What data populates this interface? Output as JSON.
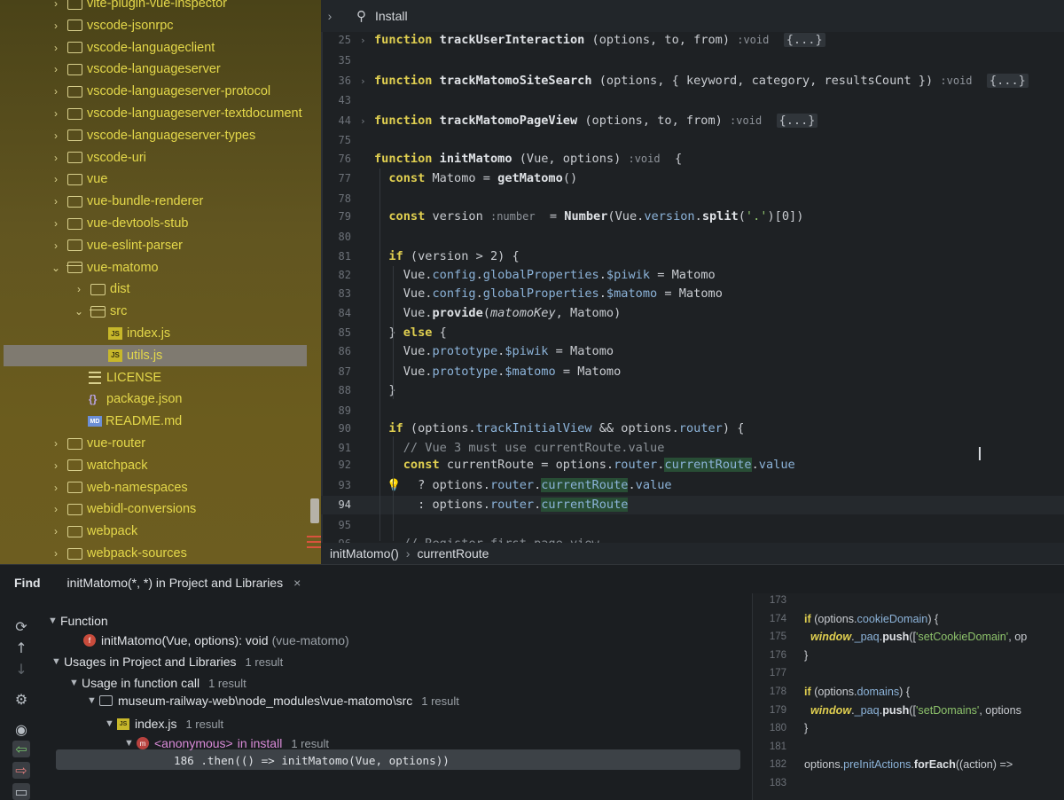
{
  "tree": {
    "items": [
      {
        "label": "vite-plugin-vue-inspector",
        "type": "folder",
        "depth": 0,
        "expanded": false
      },
      {
        "label": "vscode-jsonrpc",
        "type": "folder",
        "depth": 0,
        "expanded": false
      },
      {
        "label": "vscode-languageclient",
        "type": "folder",
        "depth": 0,
        "expanded": false
      },
      {
        "label": "vscode-languageserver",
        "type": "folder",
        "depth": 0,
        "expanded": false
      },
      {
        "label": "vscode-languageserver-protocol",
        "type": "folder",
        "depth": 0,
        "expanded": false
      },
      {
        "label": "vscode-languageserver-textdocument",
        "type": "folder",
        "depth": 0,
        "expanded": false
      },
      {
        "label": "vscode-languageserver-types",
        "type": "folder",
        "depth": 0,
        "expanded": false
      },
      {
        "label": "vscode-uri",
        "type": "folder",
        "depth": 0,
        "expanded": false
      },
      {
        "label": "vue",
        "type": "folder",
        "depth": 0,
        "expanded": false
      },
      {
        "label": "vue-bundle-renderer",
        "type": "folder",
        "depth": 0,
        "expanded": false
      },
      {
        "label": "vue-devtools-stub",
        "type": "folder",
        "depth": 0,
        "expanded": false
      },
      {
        "label": "vue-eslint-parser",
        "type": "folder",
        "depth": 0,
        "expanded": false
      },
      {
        "label": "vue-matomo",
        "type": "folder",
        "depth": 0,
        "expanded": true
      },
      {
        "label": "dist",
        "type": "folder",
        "depth": 1,
        "expanded": false
      },
      {
        "label": "src",
        "type": "folder",
        "depth": 1,
        "expanded": true
      },
      {
        "label": "index.js",
        "type": "js",
        "depth": 2
      },
      {
        "label": "utils.js",
        "type": "js",
        "depth": 2,
        "selected": true
      },
      {
        "label": "LICENSE",
        "type": "txt",
        "depth": 1
      },
      {
        "label": "package.json",
        "type": "json",
        "depth": 1
      },
      {
        "label": "README.md",
        "type": "md",
        "depth": 1
      },
      {
        "label": "vue-router",
        "type": "folder",
        "depth": 0,
        "expanded": false
      },
      {
        "label": "watchpack",
        "type": "folder",
        "depth": 0,
        "expanded": false
      },
      {
        "label": "web-namespaces",
        "type": "folder",
        "depth": 0,
        "expanded": false
      },
      {
        "label": "webidl-conversions",
        "type": "folder",
        "depth": 0,
        "expanded": false
      },
      {
        "label": "webpack",
        "type": "folder",
        "depth": 0,
        "expanded": false
      },
      {
        "label": "webpack-sources",
        "type": "folder",
        "depth": 0,
        "expanded": false
      }
    ]
  },
  "editor": {
    "search_label": "Install",
    "lines": [
      {
        "n": "25",
        "fold": true,
        "html": "<span class='kw'>function</span> <span class='fn'>trackUserInteraction</span> (options, to, from) <span class='hint'>:void</span>  <span class='fold-box'>{...}</span>"
      },
      {
        "n": "35",
        "html": ""
      },
      {
        "n": "36",
        "fold": true,
        "html": "<span class='kw'>function</span> <span class='fn'>trackMatomoSiteSearch</span> (options, { keyword, category, resultsCount }) <span class='hint'>:void</span>  <span class='fold-box'>{...}</span>"
      },
      {
        "n": "43",
        "html": ""
      },
      {
        "n": "44",
        "fold": true,
        "html": "<span class='kw'>function</span> <span class='fn'>trackMatomoPageView</span> (options, to, from) <span class='hint'>:void</span>  <span class='fold-box'>{...}</span>"
      },
      {
        "n": "75",
        "html": ""
      },
      {
        "n": "76",
        "html": "<span class='kw'>function</span> <span class='fn'>initMatomo</span> (Vue, options) <span class='hint'>:void</span>  {"
      },
      {
        "n": "77",
        "html": "  <span class='kw'>const</span> Matomo = <span class='fn'>getMatomo</span>()"
      },
      {
        "n": "78",
        "html": ""
      },
      {
        "n": "79",
        "html": "  <span class='kw'>const</span> version <span class='hint'>:number</span>  = <span class='fn'>Number</span>(Vue.<span class='prop'>version</span>.<span class='fn'>split</span>(<span class='str'>'.'</span>)[0])"
      },
      {
        "n": "80",
        "html": ""
      },
      {
        "n": "81",
        "html": "  <span class='kw'>if</span> (version > 2) {"
      },
      {
        "n": "82",
        "html": "    Vue.<span class='prop'>config</span>.<span class='prop'>globalProperties</span>.<span class='prop'>$piwik</span> = Matomo"
      },
      {
        "n": "83",
        "html": "    Vue.<span class='prop'>config</span>.<span class='prop'>globalProperties</span>.<span class='prop'>$matomo</span> = Matomo"
      },
      {
        "n": "84",
        "html": "    Vue.<span class='fn'>provide</span>(<i>matomoKey</i>, Matomo)"
      },
      {
        "n": "85",
        "html": "  } <span class='kw'>else</span> {"
      },
      {
        "n": "86",
        "html": "    Vue.<span class='prop'>prototype</span>.<span class='prop'>$piwik</span> = Matomo"
      },
      {
        "n": "87",
        "html": "    Vue.<span class='prop'>prototype</span>.<span class='prop'>$matomo</span> = Matomo"
      },
      {
        "n": "88",
        "html": "  }"
      },
      {
        "n": "89",
        "html": ""
      },
      {
        "n": "90",
        "html": "  <span class='kw'>if</span> (options.<span class='prop'>trackInitialView</span> && options.<span class='prop'>router</span>) {"
      },
      {
        "n": "91",
        "html": "    <span class='cm'>// Vue 3 must use currentRoute.value</span>"
      },
      {
        "n": "92",
        "html": "    <span class='kw'>const</span> currentRoute = options.<span class='prop'>router</span>.<span class='mark'><span class='prop'>currentRoute</span></span>.<span class='prop'>value</span>"
      },
      {
        "n": "93",
        "bulb": true,
        "html": "      ? options.<span class='prop'>router</span>.<span class='mark'><span class='prop'>currentRoute</span></span>.<span class='prop'>value</span>"
      },
      {
        "n": "94",
        "current": true,
        "html": "      : options.<span class='prop'>router</span>.<span class='mark'><span class='prop'>currentRoute</span></span>"
      },
      {
        "n": "95",
        "html": ""
      },
      {
        "n": "96",
        "html": "    <span class='cm'>// Register first page view</span>"
      }
    ]
  },
  "breadcrumb": {
    "items": [
      "initMatomo()",
      "currentRoute"
    ]
  },
  "find": {
    "title": "Find",
    "tab_label": "initMatomo(*, *) in Project and Libraries",
    "close_glyph": "×",
    "function_header": "Function",
    "function_sig": "initMatomo(Vue, options): void",
    "function_module": "(vue-matomo)",
    "usages_header": "Usages in Project and Libraries",
    "usages_count": "1 result",
    "usage_kind": "Usage in function call",
    "usage_kind_count": "1 result",
    "path": "museum-railway-web\\node_modules\\vue-matomo\\src",
    "path_count": "1 result",
    "file": "index.js",
    "file_count": "1 result",
    "anon": "<anonymous>",
    "anon_in": "in install",
    "anon_count": "1 result",
    "usage_line": "186 .then(() => initMatomo(Vue, options))"
  },
  "preview": {
    "lines": [
      {
        "n": "173",
        "html": ""
      },
      {
        "n": "174",
        "html": "<span class='kw'>if</span> (options.<span class='prop'>cookieDomain</span>) {"
      },
      {
        "n": "175",
        "html": "  <span class='win'>window</span>.<span class='prop'>_paq</span>.<span class='fn'>push</span>([<span class='str'>'setCookieDomain'</span>, op"
      },
      {
        "n": "176",
        "html": "}"
      },
      {
        "n": "177",
        "html": ""
      },
      {
        "n": "178",
        "html": "<span class='kw'>if</span> (options.<span class='prop'>domains</span>) {"
      },
      {
        "n": "179",
        "html": "  <span class='win'>window</span>.<span class='prop'>_paq</span>.<span class='fn'>push</span>([<span class='str'>'setDomains'</span>, options"
      },
      {
        "n": "180",
        "html": "}"
      },
      {
        "n": "181",
        "html": ""
      },
      {
        "n": "182",
        "html": "options.<span class='prop'>preInitActions</span>.<span class='fn'>forEach</span>((action) =>"
      },
      {
        "n": "183",
        "html": ""
      }
    ]
  },
  "colors": {
    "tree_text": "#e4d84a",
    "keyword": "#e0cf50",
    "accent_match": "#284d35"
  }
}
